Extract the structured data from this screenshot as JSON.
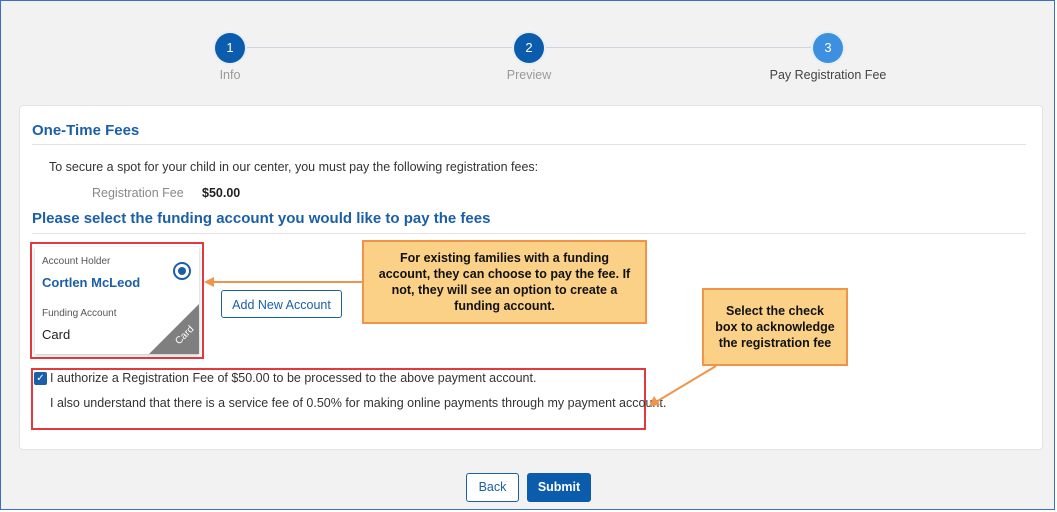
{
  "stepper": {
    "steps": [
      {
        "number": "1",
        "label": "Info"
      },
      {
        "number": "2",
        "label": "Preview"
      },
      {
        "number": "3",
        "label": "Pay Registration Fee"
      }
    ]
  },
  "fees": {
    "title": "One-Time Fees",
    "intro": "To secure a spot for your child in our center, you must pay the following registration fees:",
    "fee_label": "Registration Fee",
    "fee_value": "$50.00"
  },
  "funding": {
    "title": "Please select the funding account you would like to pay the fees",
    "account": {
      "holder_caption": "Account Holder",
      "holder_name": "Cortlen McLeod",
      "type_caption": "Funding Account",
      "type_value": "Card",
      "badge": "Card"
    },
    "add_button": "Add New Account"
  },
  "authorization": {
    "checked": true,
    "line1": "I authorize a Registration Fee of $50.00 to be processed to the above payment account.",
    "line2": "I also understand that there is a service fee of 0.50% for making online payments through my payment account."
  },
  "callouts": {
    "funding_note": "For existing families with a funding account, they can choose to pay the fee. If not, they will see an option to create a funding account.",
    "checkbox_note": "Select the check box to acknowledge the registration fee"
  },
  "footer": {
    "back_label": "Back",
    "submit_label": "Submit"
  },
  "colors": {
    "primary": "#0b5cad",
    "highlight_border": "#e0393e",
    "callout_fill": "#fbd187",
    "callout_border": "#f0944a"
  }
}
